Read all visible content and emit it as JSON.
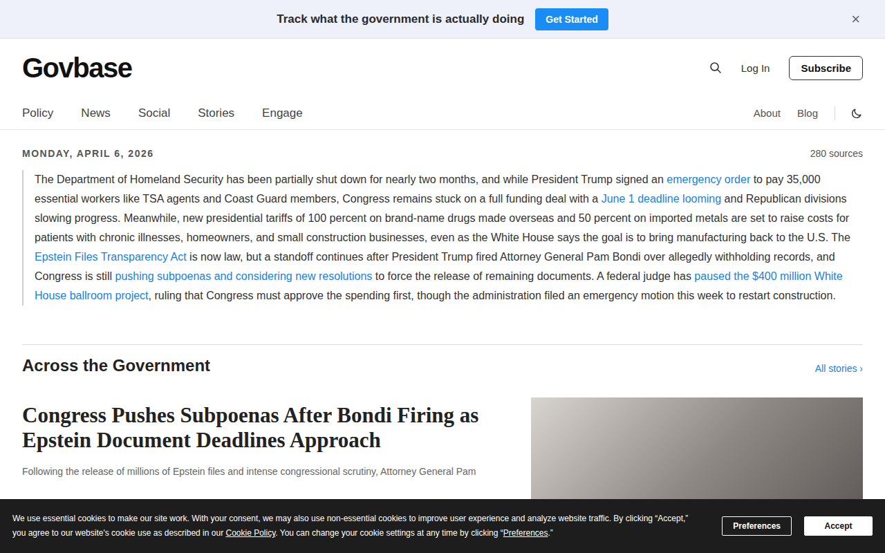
{
  "banner": {
    "text": "Track what the government is actually doing",
    "button": "Get Started",
    "close": "×"
  },
  "header": {
    "logo": "Govbase",
    "login": "Log In",
    "subscribe": "Subscribe"
  },
  "nav": {
    "primary": [
      "Policy",
      "News",
      "Social",
      "Stories",
      "Engage"
    ],
    "secondary": [
      "About",
      "Blog"
    ]
  },
  "briefing": {
    "date": "MONDAY, APRIL 6, 2026",
    "sources": "280 sources",
    "segments": [
      {
        "text": "The Department of Homeland Security has been partially shut down for nearly two months, and while President Trump signed an ",
        "link": false
      },
      {
        "text": "emergency order",
        "link": true
      },
      {
        "text": " to pay 35,000 essential workers like TSA agents and Coast Guard members, Congress remains stuck on a full funding deal with a ",
        "link": false
      },
      {
        "text": "June 1 deadline looming",
        "link": true
      },
      {
        "text": " and Republican divisions slowing progress. Meanwhile, new presidential tariffs of 100 percent on brand-name drugs made overseas and 50 percent on imported metals are set to raise costs for patients with chronic illnesses, homeowners, and small construction businesses, even as the White House says the goal is to bring manufacturing back to the U.S. The ",
        "link": false
      },
      {
        "text": "Epstein Files Transparency Act",
        "link": true
      },
      {
        "text": " is now law, but a standoff continues after President Trump fired Attorney General Pam Bondi over allegedly withholding records, and Congress is still ",
        "link": false
      },
      {
        "text": "pushing subpoenas and considering new resolutions",
        "link": true
      },
      {
        "text": " to force the release of remaining documents. A federal judge has ",
        "link": false
      },
      {
        "text": "paused the $400 million White House ballroom project",
        "link": true
      },
      {
        "text": ", ruling that Congress must approve the spending first, though the administration filed an emergency motion this week to restart construction.",
        "link": false
      }
    ]
  },
  "section": {
    "title": "Across the Government",
    "link": "All stories ›"
  },
  "story": {
    "title": "Congress Pushes Subpoenas After Bondi Firing as Epstein Document Deadlines Approach",
    "excerpt": "Following the release of millions of Epstein files and intense congressional scrutiny, Attorney General Pam"
  },
  "cookie": {
    "segments": [
      {
        "text": "We use essential cookies to make our site work. With your consent, we may also use non-essential cookies to improve user experience and analyze website traffic. By clicking “Accept,” you agree to our website's cookie use as described in our ",
        "link": false
      },
      {
        "text": "Cookie Policy",
        "link": true
      },
      {
        "text": ". You can change your cookie settings at any time by clicking “",
        "link": false
      },
      {
        "text": "Preferences",
        "link": true
      },
      {
        "text": ".”",
        "link": false
      }
    ],
    "buttons": [
      {
        "label": "Preferences",
        "kind": "outline"
      },
      {
        "label": "Accept",
        "kind": "solid"
      }
    ]
  }
}
